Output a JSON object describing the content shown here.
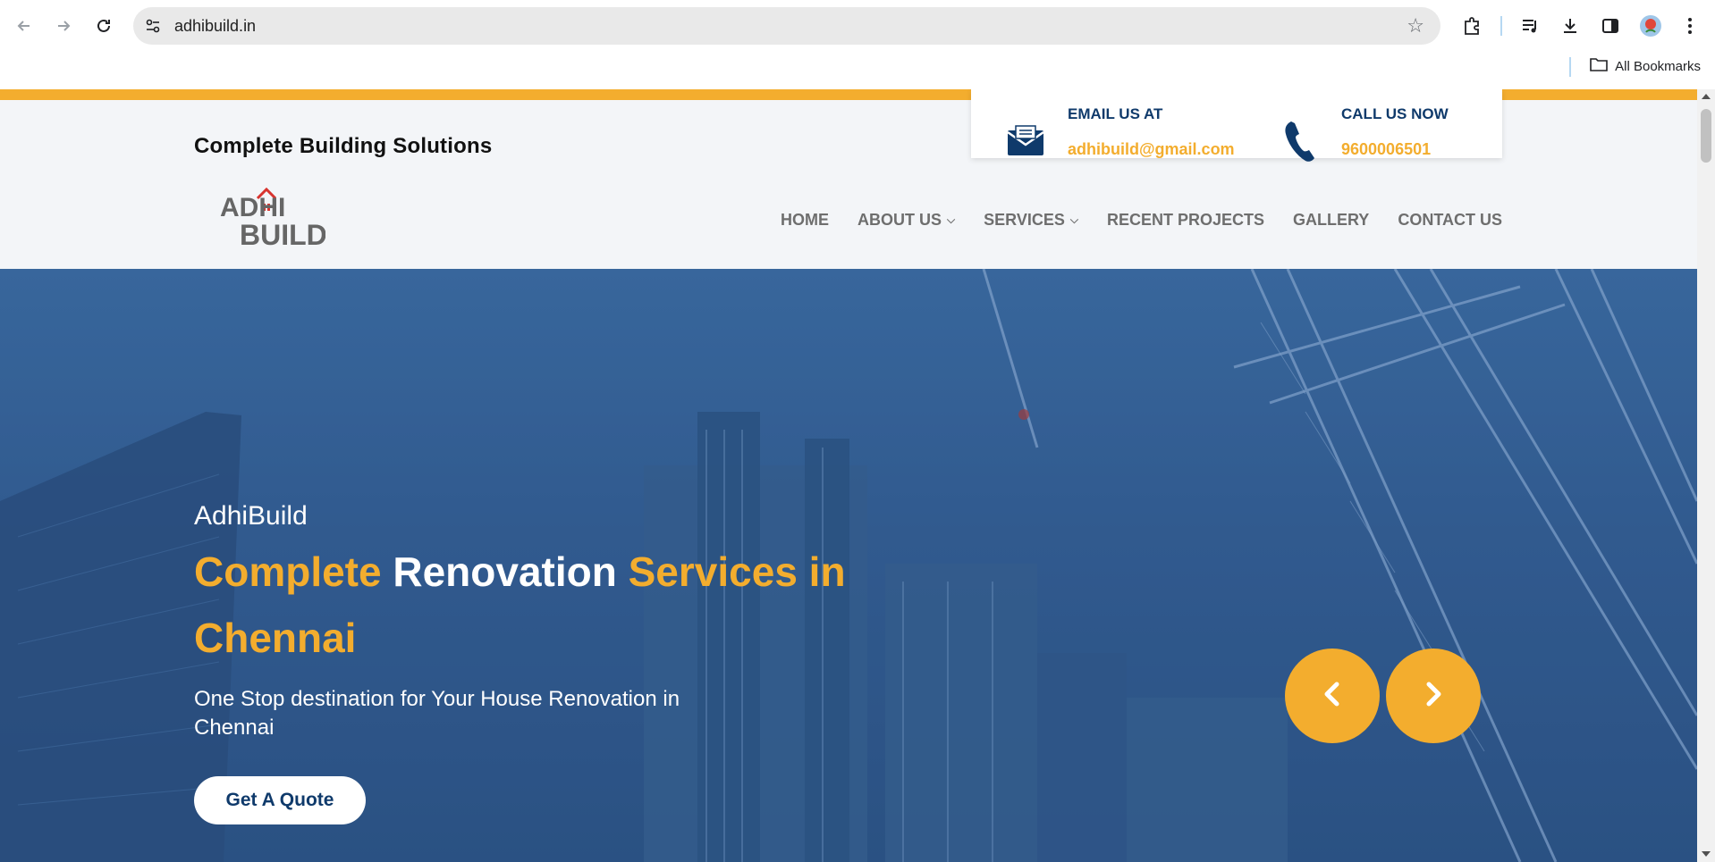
{
  "browser": {
    "url": "adhibuild.in",
    "bookmarks_label": "All Bookmarks"
  },
  "header": {
    "tagline": "Complete Building Solutions",
    "email_label": "EMAIL US AT",
    "email_value": "adhibuild@gmail.com",
    "call_label": "CALL US NOW",
    "call_value": "9600006501",
    "logo_top": "ADHI",
    "logo_bottom": "BUILD"
  },
  "menu": {
    "items": [
      {
        "label": "HOME",
        "has_dropdown": false
      },
      {
        "label": "ABOUT US",
        "has_dropdown": true
      },
      {
        "label": "SERVICES",
        "has_dropdown": true
      },
      {
        "label": "RECENT PROJECTS",
        "has_dropdown": false
      },
      {
        "label": "GALLERY",
        "has_dropdown": false
      },
      {
        "label": "CONTACT US",
        "has_dropdown": false
      }
    ]
  },
  "hero": {
    "eyebrow": "AdhiBuild",
    "title_part1": "Complete",
    "title_part2": "Renovation",
    "title_part3": "Services in",
    "title_part4": "Chennai",
    "subtitle": "One Stop destination for Your House Renovation in Chennai",
    "cta_label": "Get A Quote"
  },
  "colors": {
    "accent": "#f3ad2e",
    "navy": "#0f3a6b",
    "menu_text": "#6e6e6e"
  },
  "icons": {
    "email": "envelope-icon",
    "phone": "phone-icon",
    "prev": "chevron-left-icon",
    "next": "chevron-right-icon"
  }
}
